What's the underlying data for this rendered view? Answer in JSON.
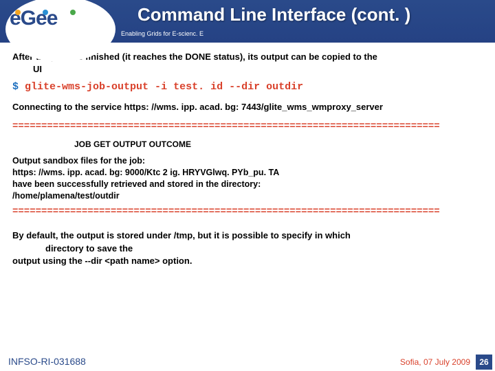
{
  "header": {
    "logo_text": "eGee",
    "title": "Command Line Interface (cont. )",
    "tagline": "Enabling Grids for E-scienc. E"
  },
  "body": {
    "intro_line1": "After the job has finished (it reaches the DONE status), its output can be copied to the",
    "intro_line2": "UI",
    "dollar": "$",
    "command": "glite-wms-job-output -i test. id --dir outdir",
    "connecting": "Connecting to the service https: //wms. ipp. acad. bg: 7443/glite_wms_wmproxy_server",
    "separator": "==========================================================================",
    "outcome_title": "JOB GET OUTPUT OUTCOME",
    "outcome_l1": "Output sandbox files for the job:",
    "outcome_l2": "https: //wms. ipp. acad. bg: 9000/Ktc 2 ig. HRYVGlwq. PYb_pu. TA",
    "outcome_l3": "have been successfully retrieved and stored in the directory:",
    "outcome_l4": "/home/plamena/test/outdir",
    "bottom_l1": "By default, the output is stored under /tmp, but it is possible to specify in which",
    "bottom_l2": "directory to save the",
    "bottom_l3": "output using the --dir <path name> option."
  },
  "footer": {
    "left": "INFSO-RI-031688",
    "right": "Sofia, 07 July 2009",
    "slide": "26"
  }
}
